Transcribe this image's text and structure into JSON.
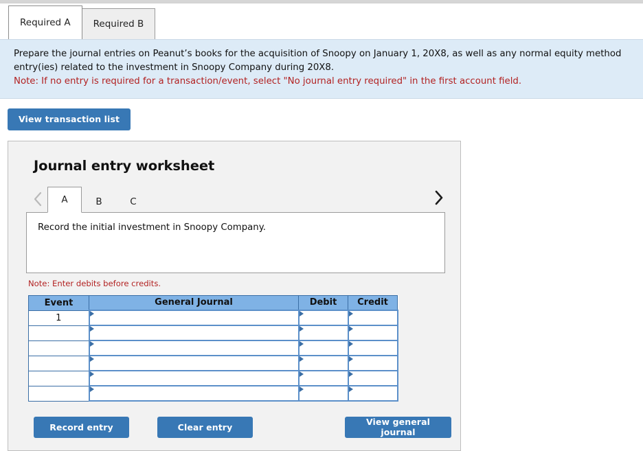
{
  "required_tabs": [
    {
      "label": "Required A",
      "active": true
    },
    {
      "label": "Required B",
      "active": false
    }
  ],
  "instructions": {
    "line1": "Prepare the journal entries on Peanut’s books for the acquisition of Snoopy on January 1, 20X8, as well as any normal equity method",
    "line2": "entry(ies) related to the investment in Snoopy Company during 20X8.",
    "note": "Note: If no entry is required for a transaction/event, select \"No journal entry required\" in the first account field."
  },
  "toolbar": {
    "view_transaction_list_label": "View transaction list"
  },
  "worksheet": {
    "title": "Journal entry worksheet",
    "pager": {
      "prev_icon": "chevron-left-icon",
      "next_icon": "chevron-right-icon",
      "tabs": [
        {
          "label": "A",
          "active": true
        },
        {
          "label": "B",
          "active": false
        },
        {
          "label": "C",
          "active": false
        }
      ]
    },
    "description": "Record the initial investment in Snoopy Company.",
    "note": "Note: Enter debits before credits.",
    "table": {
      "headers": [
        "Event",
        "General Journal",
        "Debit",
        "Credit"
      ],
      "rows": [
        {
          "event": "1",
          "general_journal": "",
          "debit": "",
          "credit": ""
        },
        {
          "event": "",
          "general_journal": "",
          "debit": "",
          "credit": ""
        },
        {
          "event": "",
          "general_journal": "",
          "debit": "",
          "credit": ""
        },
        {
          "event": "",
          "general_journal": "",
          "debit": "",
          "credit": ""
        },
        {
          "event": "",
          "general_journal": "",
          "debit": "",
          "credit": ""
        },
        {
          "event": "",
          "general_journal": "",
          "debit": "",
          "credit": ""
        }
      ]
    },
    "buttons": {
      "record_entry": "Record entry",
      "clear_entry": "Clear entry",
      "view_general_journal": "View general journal"
    }
  },
  "colors": {
    "button_blue": "#3878b5",
    "table_header_blue": "#7fb2e5",
    "table_border_blue": "#3a6ea5",
    "info_panel_blue": "#ddebf7",
    "note_red": "#b22222",
    "panel_gray": "#f2f2f2"
  }
}
